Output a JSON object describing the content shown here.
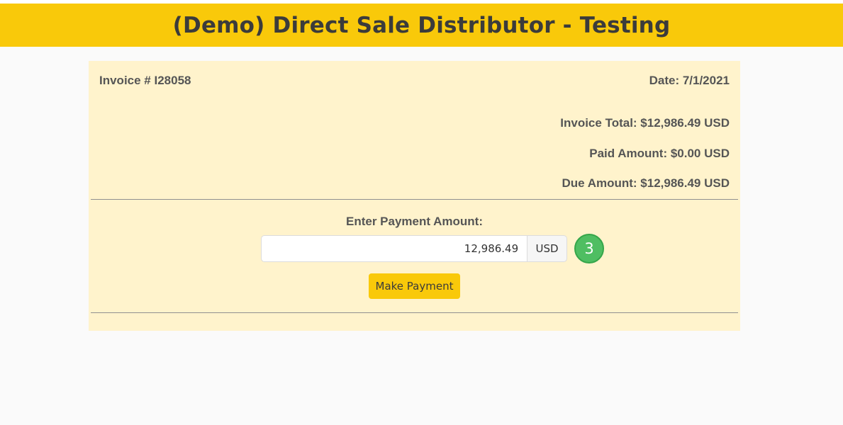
{
  "header": {
    "title": "(Demo) Direct Sale Distributor - Testing"
  },
  "invoice": {
    "number_label": "Invoice # I28058",
    "date_label": "Date: 7/1/2021",
    "total_label": "Invoice Total: $12,986.49 USD",
    "paid_label": "Paid Amount: $0.00 USD",
    "due_label": "Due Amount: $12,986.49 USD"
  },
  "payment": {
    "prompt": "Enter Payment Amount:",
    "amount_value": "12,986.49",
    "currency": "USD",
    "step_number": "3",
    "button_label": "Make Payment"
  },
  "colors": {
    "header_bg": "#f9c90a",
    "card_bg": "#fff3cc",
    "badge_green": "#4fbe62",
    "button_bg": "#f9c90a"
  }
}
